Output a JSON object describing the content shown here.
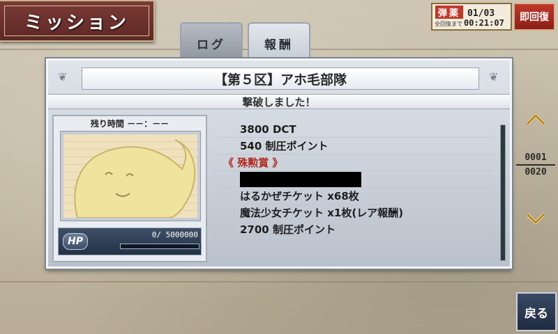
{
  "header": {
    "title": "ミッション"
  },
  "ammo": {
    "label": "弾薬",
    "count": "01/03",
    "recovery_label": "全回復まで",
    "timer": "00:21:07",
    "instant_recovery": "即回復"
  },
  "tabs": [
    {
      "label": "ログ",
      "active": false
    },
    {
      "label": "報酬",
      "active": true
    }
  ],
  "panel": {
    "title": "【第５区】アホ毛部隊",
    "status": "撃破しました！"
  },
  "boss": {
    "remaining_time_label": "残り時間",
    "remaining_time": "－－：－－",
    "hp_label": "HP",
    "hp_text": "0/  5000000",
    "hp_current": 0,
    "hp_max": 5000000
  },
  "rewards": [
    {
      "type": "normal",
      "text": "3800 DCT"
    },
    {
      "type": "normal",
      "text": "540 制圧ポイント"
    },
    {
      "type": "header",
      "text": "《 殊勲賞 》"
    },
    {
      "type": "redacted",
      "text": ""
    },
    {
      "type": "normal",
      "text": "はるかぜチケット x68枚"
    },
    {
      "type": "normal",
      "text": "魔法少女チケット x1枚(レア報酬)"
    },
    {
      "type": "normal",
      "text": "2700 制圧ポイント"
    }
  ],
  "pagination": {
    "current": "0001",
    "total": "0020"
  },
  "back_button": "戻る",
  "colors": {
    "accent_red": "#c0392b",
    "panel": "#dfe4ea",
    "hp_bar": "#5fb04a"
  }
}
